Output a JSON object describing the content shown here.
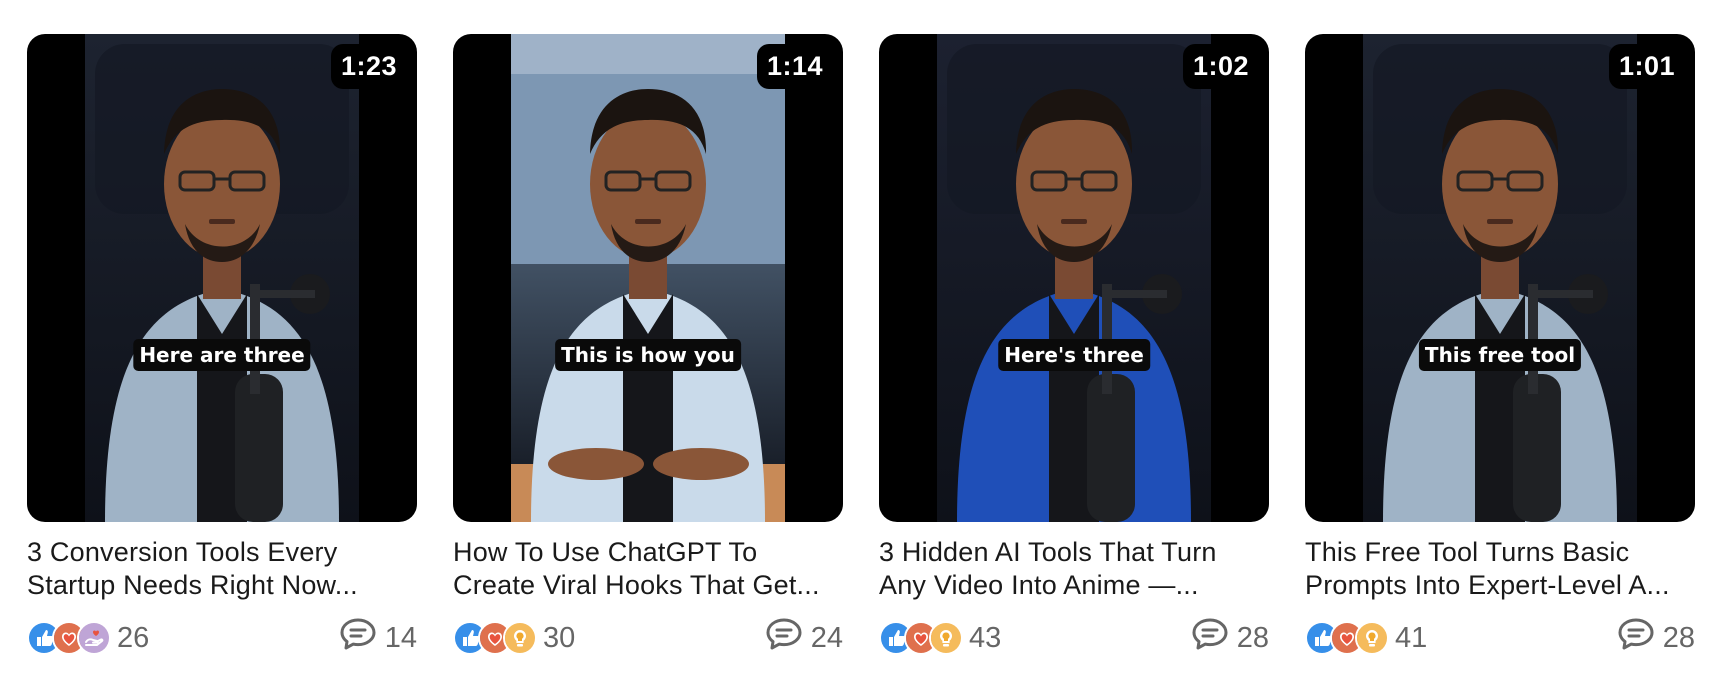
{
  "videos": [
    {
      "duration": "1:23",
      "caption": "Here are three",
      "title": "3 Conversion Tools Every Startup Needs Right Now...",
      "reactions": [
        "like-icon",
        "love-icon",
        "support-icon"
      ],
      "reaction_count": "26",
      "comment_count": "14",
      "shirt_color": "#9fb3c6",
      "bg_color": "#1d2330"
    },
    {
      "duration": "1:14",
      "caption": "This is how you",
      "title": "How To Use ChatGPT To Create Viral Hooks That Get...",
      "reactions": [
        "like-icon",
        "love-icon",
        "insightful-icon"
      ],
      "reaction_count": "30",
      "comment_count": "24",
      "shirt_color": "#c9daea",
      "bg_color": "#6f8aa6"
    },
    {
      "duration": "1:02",
      "caption": "Here's three",
      "title": "3 Hidden AI Tools That Turn Any Video Into Anime —...",
      "reactions": [
        "like-icon",
        "love-icon",
        "insightful-icon"
      ],
      "reaction_count": "43",
      "comment_count": "28",
      "shirt_color": "#1f4fb8",
      "bg_color": "#1c2130"
    },
    {
      "duration": "1:01",
      "caption": "This free tool",
      "title": "This Free Tool Turns Basic Prompts Into Expert-Level A...",
      "reactions": [
        "like-icon",
        "love-icon",
        "insightful-icon"
      ],
      "reaction_count": "41",
      "comment_count": "28",
      "shirt_color": "#9fb3c6",
      "bg_color": "#1d2330"
    }
  ],
  "colors": {
    "like": "#378fe9",
    "love": "#df704d",
    "insightful": "#f5bb5c",
    "support": "#bfa5d6",
    "meta_text": "#666666"
  }
}
